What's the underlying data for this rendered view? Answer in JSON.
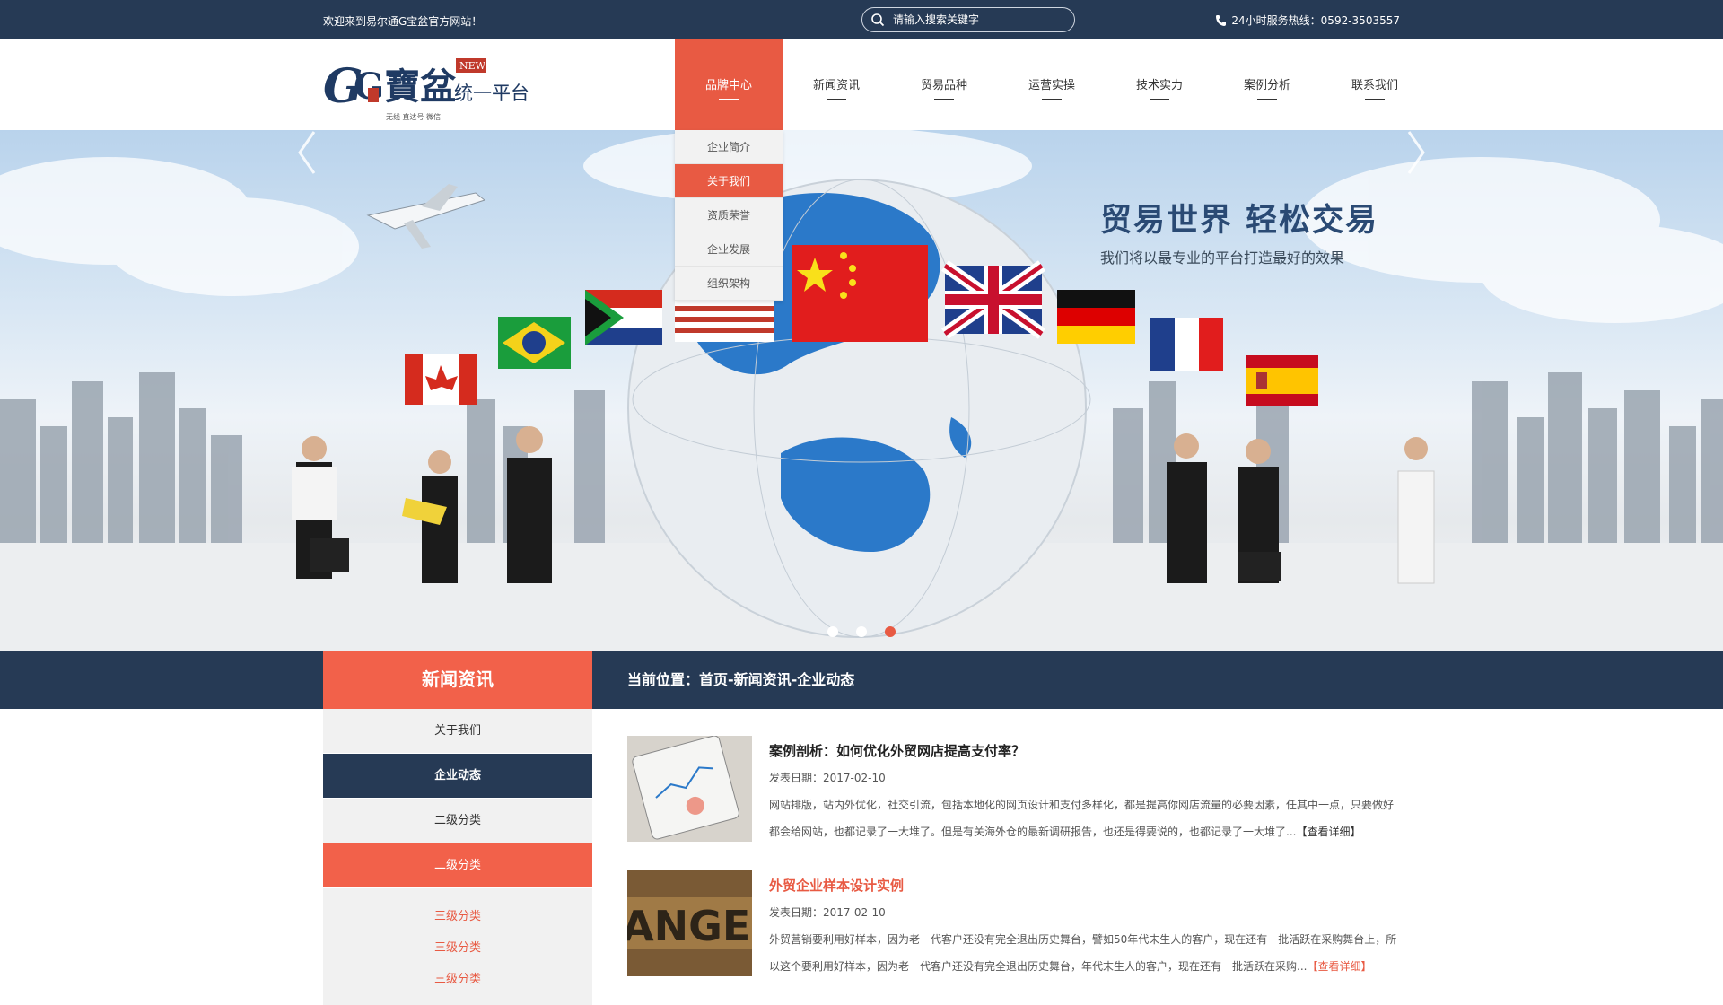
{
  "topbar": {
    "welcome": "欢迎来到易尔通G宝盆官方网站！",
    "search_placeholder": "请输入搜索关键字",
    "hotline": "24小时服务热线：0592-3503557"
  },
  "logo": {
    "main": "G寶盆",
    "tagline": "统一平台",
    "badge": "NEW",
    "sub": "无线 直达号 微信"
  },
  "nav": {
    "items": [
      {
        "label": "品牌中心"
      },
      {
        "label": "新闻资讯"
      },
      {
        "label": "贸易品种"
      },
      {
        "label": "运营实操"
      },
      {
        "label": "技术实力"
      },
      {
        "label": "案例分析"
      },
      {
        "label": "联系我们"
      }
    ],
    "active_index": 0,
    "dropdown": [
      "企业简介",
      "关于我们",
      "资质荣誉",
      "企业发展",
      "组织架构"
    ]
  },
  "banner": {
    "headline": "贸易世界 轻松交易",
    "subline": "我们将以最专业的平台打造最好的效果",
    "dots": 3,
    "active_dot": 2
  },
  "section": {
    "heading": "新闻资讯",
    "breadcrumb": "当前位置：首页-新闻资讯-企业动态"
  },
  "sidebar": {
    "items": [
      "关于我们",
      "企业动态",
      "二级分类",
      "二级分类"
    ],
    "sub_items": [
      "三级分类",
      "三级分类",
      "三级分类"
    ]
  },
  "articles": [
    {
      "title": "案例剖析：如何优化外贸网店提高支付率？",
      "date": "发表日期：2017-02-10",
      "desc": "网站排版，站内外优化，社交引流，包括本地化的网页设计和支付多样化，都是提高你网店流量的必要因素，任其中一点，只要做好都会给网站，也都记录了一大堆了。但是有关海外仓的最新调研报告，也还是得要说的，也都记录了一大堆了...",
      "more": "【查看详细】"
    },
    {
      "title": "外贸企业样本设计实例",
      "date": "发表日期：2017-02-10",
      "desc": "外贸营销要利用好样本，因为老一代客户还没有完全退出历史舞台，譬如50年代末生人的客户，现在还有一批活跃在采购舞台上，所以这个要利用好样本，因为老一代客户还没有完全退出历史舞台，年代末生人的客户，现在还有一批活跃在采购...",
      "more": "【查看详细】"
    }
  ]
}
